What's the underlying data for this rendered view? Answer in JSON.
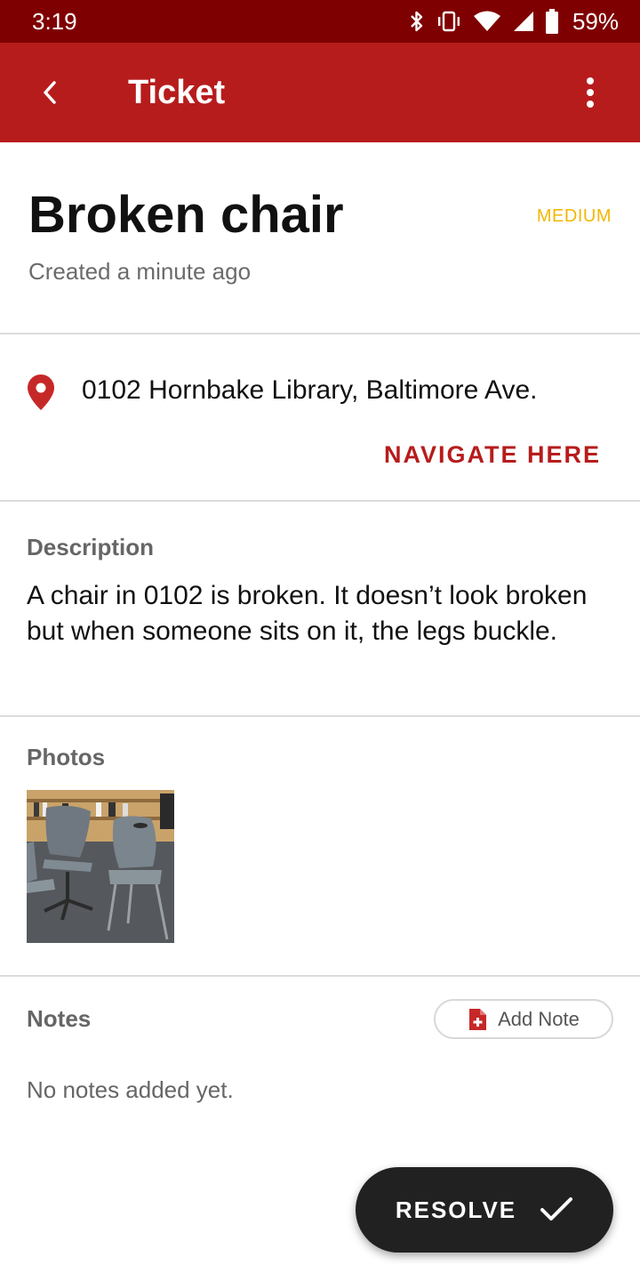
{
  "status_bar": {
    "time": "3:19",
    "battery": "59%"
  },
  "app_bar": {
    "title": "Ticket"
  },
  "ticket": {
    "title": "Broken chair",
    "priority": "MEDIUM",
    "created": "Created a minute ago"
  },
  "location": {
    "address": "0102 Hornbake Library, Baltimore Ave.",
    "navigate_label": "NAVIGATE HERE"
  },
  "description": {
    "label": "Description",
    "text": "A chair in 0102 is broken. It doesn’t look broken but when someone sits on it, the legs buckle."
  },
  "photos": {
    "label": "Photos"
  },
  "notes": {
    "label": "Notes",
    "add_label": "Add Note",
    "empty_text": "No notes added yet."
  },
  "fab": {
    "label": "RESOLVE"
  },
  "colors": {
    "status_bar": "#7f0000",
    "app_bar": "#b71c1c",
    "priority_medium": "#f2b705",
    "accent": "#b71c1c",
    "fab": "#212121"
  },
  "icons": [
    "bluetooth-icon",
    "vibrate-icon",
    "wifi-icon",
    "signal-icon",
    "battery-icon",
    "back-arrow-icon",
    "more-vert-icon",
    "location-pin-icon",
    "note-add-icon",
    "check-icon"
  ]
}
